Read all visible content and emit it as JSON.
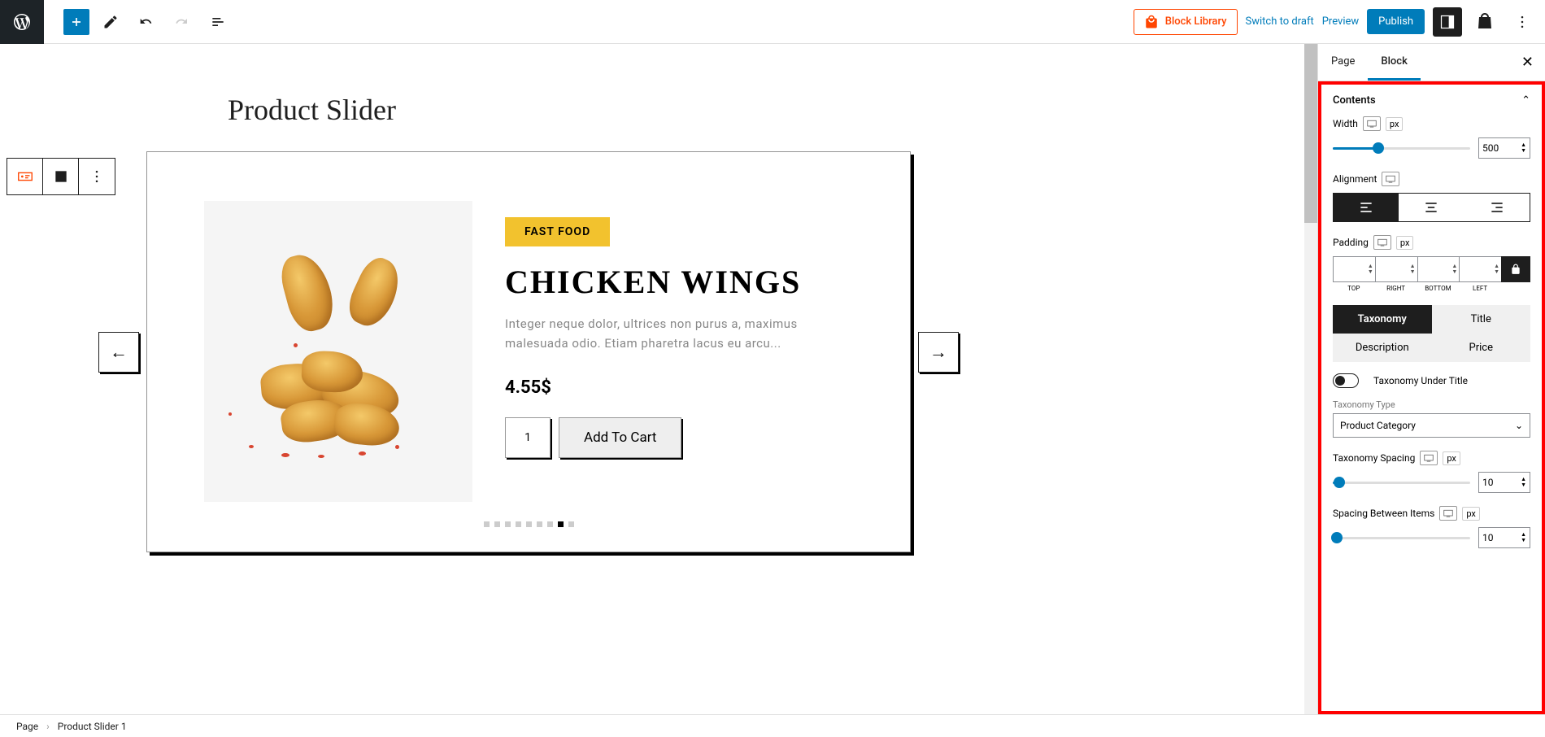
{
  "toolbar": {
    "block_library": "Block Library",
    "switch_to_draft": "Switch to draft",
    "preview": "Preview",
    "publish": "Publish"
  },
  "page_title": "Product Slider",
  "product": {
    "category": "FAST FOOD",
    "title": "CHICKEN WINGS",
    "description": "Integer neque dolor, ultrices non purus a, maximus malesuada odio. Etiam pharetra lacus eu arcu...",
    "price": "4.55$",
    "qty": "1",
    "add_to_cart": "Add To Cart"
  },
  "sidebar": {
    "tab_page": "Page",
    "tab_block": "Block",
    "panel_title": "Contents",
    "width_label": "Width",
    "width_unit": "px",
    "width_value": "500",
    "alignment_label": "Alignment",
    "padding_label": "Padding",
    "padding_unit": "px",
    "pad_top": "TOP",
    "pad_right": "RIGHT",
    "pad_bottom": "BOTTOM",
    "pad_left": "LEFT",
    "tab_taxonomy": "Taxonomy",
    "tab_title": "Title",
    "tab_description": "Description",
    "tab_price": "Price",
    "taxonomy_under_title": "Taxonomy Under Title",
    "taxonomy_type_label": "Taxonomy Type",
    "taxonomy_type_value": "Product Category",
    "taxonomy_spacing_label": "Taxonomy Spacing",
    "taxonomy_spacing_unit": "px",
    "taxonomy_spacing_value": "10",
    "spacing_between_label": "Spacing Between Items",
    "spacing_between_unit": "px",
    "spacing_between_value": "10"
  },
  "breadcrumb": {
    "page": "Page",
    "block": "Product Slider 1"
  }
}
